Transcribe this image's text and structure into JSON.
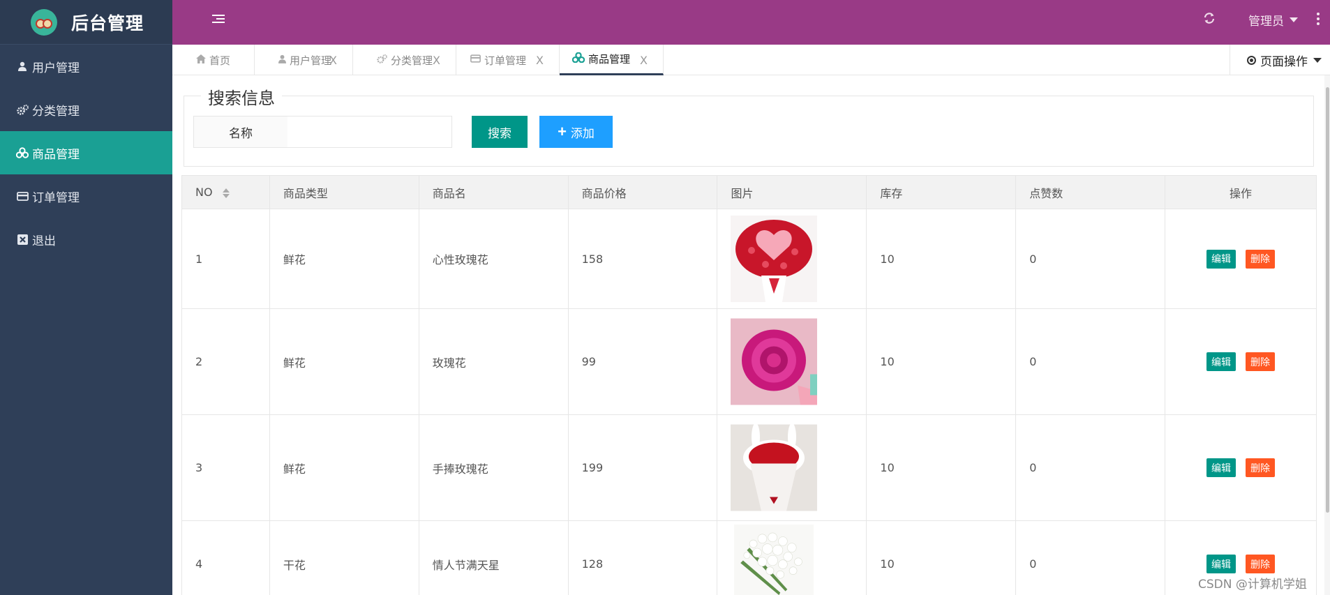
{
  "app": {
    "title": "后台管理"
  },
  "sidebar": {
    "items": [
      {
        "label": "用户管理",
        "icon": "user-icon",
        "active": false
      },
      {
        "label": "分类管理",
        "icon": "gears-icon",
        "active": false
      },
      {
        "label": "商品管理",
        "icon": "cubes-icon",
        "active": true
      },
      {
        "label": "订单管理",
        "icon": "credit-card-icon",
        "active": false
      },
      {
        "label": "退出",
        "icon": "close-box-icon",
        "active": false
      }
    ]
  },
  "header": {
    "user": "管理员",
    "refresh_icon": "refresh-icon",
    "more_icon": "more-vertical-icon"
  },
  "tabs": [
    {
      "label": "首页",
      "icon": "home-icon",
      "closable": false,
      "active": false
    },
    {
      "label": "用户管理",
      "icon": "user-icon",
      "closable": true,
      "active": false
    },
    {
      "label": "分类管理",
      "icon": "gears-icon",
      "closable": true,
      "active": false
    },
    {
      "label": "订单管理",
      "icon": "credit-card-icon",
      "closable": true,
      "active": false
    },
    {
      "label": "商品管理",
      "icon": "cubes-icon",
      "closable": true,
      "active": true
    }
  ],
  "tab_close": "X",
  "page_ops": "页面操作",
  "search": {
    "legend": "搜索信息",
    "name_label": "名称",
    "name_value": "",
    "search_button": "搜索",
    "add_button": "添加"
  },
  "table": {
    "columns": [
      "NO",
      "商品类型",
      "商品名",
      "商品价格",
      "图片",
      "库存",
      "点赞数",
      "操作"
    ],
    "rows": [
      {
        "no": "1",
        "type": "鲜花",
        "name": "心性玫瑰花",
        "price": "158",
        "stock": "10",
        "likes": "0"
      },
      {
        "no": "2",
        "type": "鲜花",
        "name": "玫瑰花",
        "price": "99",
        "stock": "10",
        "likes": "0"
      },
      {
        "no": "3",
        "type": "鲜花",
        "name": "手捧玫瑰花",
        "price": "199",
        "stock": "10",
        "likes": "0"
      },
      {
        "no": "4",
        "type": "干花",
        "name": "情人节满天星",
        "price": "128",
        "stock": "10",
        "likes": "0"
      }
    ],
    "edit_label": "编辑",
    "delete_label": "删除"
  },
  "watermark": "CSDN @计算机学姐",
  "colors": {
    "sidebar": "#2f3f58",
    "header": "#993a86",
    "active": "#1aa094",
    "primary": "#009688",
    "blue": "#1e9fff",
    "danger": "#ff5722"
  }
}
